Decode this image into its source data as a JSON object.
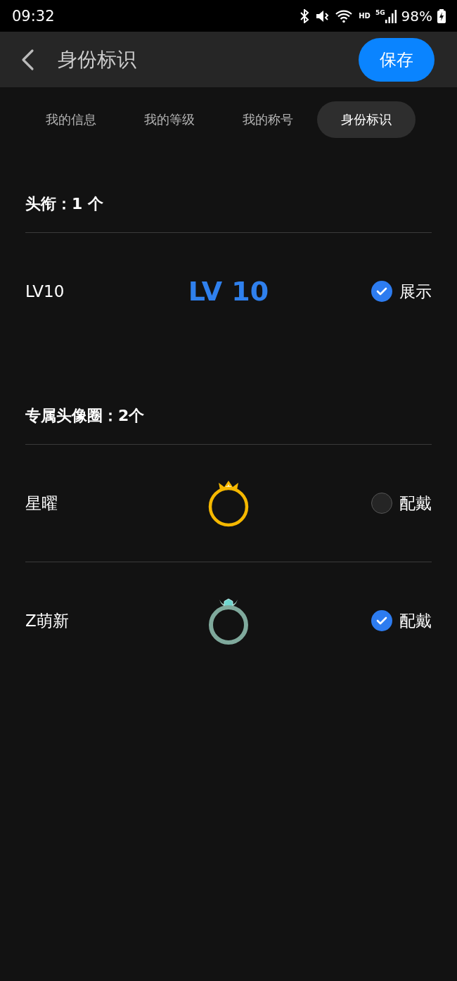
{
  "status_bar": {
    "time": "09:32",
    "network_label": "HD",
    "generation": "5G",
    "battery": "98%"
  },
  "header": {
    "title": "身份标识",
    "save_button": "保存"
  },
  "tabs": [
    {
      "label": "我的信息",
      "selected": false
    },
    {
      "label": "我的等级",
      "selected": false
    },
    {
      "label": "我的称号",
      "selected": false
    },
    {
      "label": "身份标识",
      "selected": true
    }
  ],
  "sections": [
    {
      "title": "头衔：",
      "count": "1 个",
      "items": [
        {
          "name": "LV10",
          "kind": "badge",
          "badge_text": "LV 10",
          "action": "展示",
          "checked": true
        }
      ]
    },
    {
      "title": "专属头像圈：",
      "count": "2个",
      "items": [
        {
          "name": "星曜",
          "kind": "crown-ring",
          "action": "配戴",
          "checked": false
        },
        {
          "name": "Z萌新",
          "kind": "gem-ring",
          "action": "配戴",
          "checked": true
        }
      ]
    }
  ]
}
